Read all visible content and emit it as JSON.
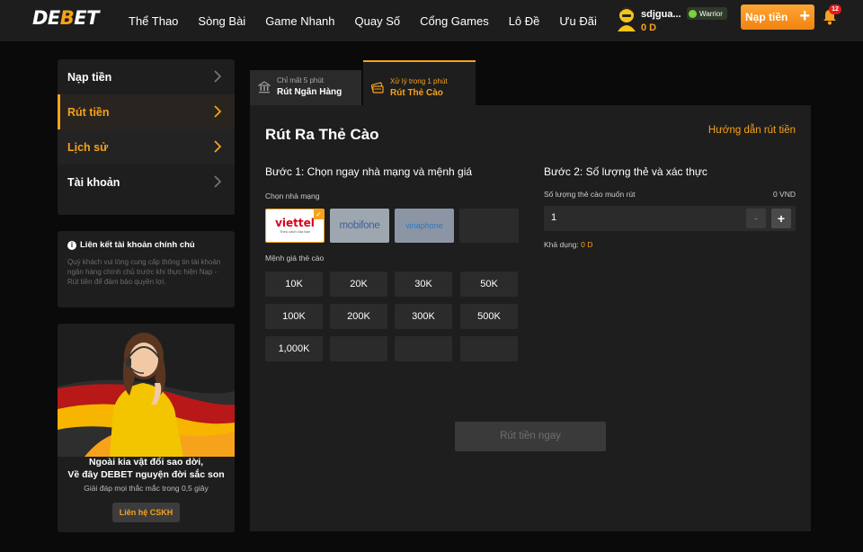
{
  "header": {
    "logo_prefix": "DE",
    "logo_o": "B",
    "logo_suffix": "ET",
    "nav": [
      "Thể Thao",
      "Sòng Bài",
      "Game Nhanh",
      "Quay Số",
      "Cổng Games",
      "Lô Đề",
      "Ưu Đãi"
    ],
    "user": {
      "name": "sdjgua...",
      "balance": "0 D",
      "rank": "Warrior"
    },
    "deposit_label": "Nạp tiền",
    "notifications": "12"
  },
  "sidebar": {
    "items": [
      {
        "label": "Nạp tiền"
      },
      {
        "label": "Rút tiền"
      },
      {
        "label": "Lịch sử"
      },
      {
        "label": "Tài khoản"
      }
    ],
    "info_title": "Liên kết tài khoản chính chủ",
    "info_text": "Quý khách vui lòng cung cấp thông tin tài khoản ngân hàng chính chủ trước khi thực hiện Nạp - Rút tiền để đảm bảo quyền lợi.",
    "promo": {
      "line1": "Ngoài kia vật đổi sao dời,",
      "line2": "Về đây DEBET nguyện đời sắc son",
      "sub": "Giải đáp mọi thắc mắc trong 0,5 giây",
      "button": "Liên hệ CSKH"
    }
  },
  "tabs": [
    {
      "sub": "Chỉ mất 5 phút",
      "main": "Rút Ngân Hàng"
    },
    {
      "sub": "Xử lý trong 1 phút",
      "main": "Rút Thẻ Cào"
    }
  ],
  "main": {
    "title": "Rút Ra Thẻ Cào",
    "guide_link": "Hướng dẫn rút tiền",
    "step1": "Bước 1: Chọn ngay nhà mạng và mệnh giá",
    "carrier_label": "Chọn nhà mạng",
    "carriers": [
      {
        "name": "viettel",
        "tagline": "Theo cách của bạn"
      },
      {
        "name": "mobifone"
      },
      {
        "name": "vinaphone"
      }
    ],
    "denom_label": "Mệnh giá thẻ cào",
    "denominations": [
      "10K",
      "20K",
      "30K",
      "50K",
      "100K",
      "200K",
      "300K",
      "500K",
      "1,000K"
    ],
    "step2": "Bước 2: Số lượng thẻ và xác thực",
    "qty_label": "Số lượng thẻ cào muốn rút",
    "qty_total": "0 VND",
    "qty_value": "1",
    "available_label": "Khả dụng:",
    "available_value": "0 D",
    "submit": "Rút tiền ngay"
  },
  "colors": {
    "accent": "#f7a21b",
    "background": "#0a0a0a",
    "panel": "#1e1e1e"
  }
}
